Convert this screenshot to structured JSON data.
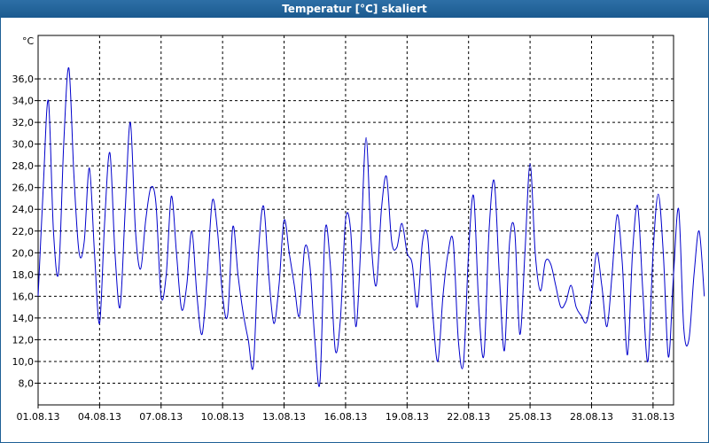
{
  "window": {
    "title": "Temperatur [°C] skaliert"
  },
  "chart_data": {
    "type": "line",
    "title": "Temperatur [°C] skaliert",
    "unit_label": "°C",
    "xlabel": "",
    "ylabel": "°C",
    "ylim": [
      6,
      40
    ],
    "xlim": [
      "2013-08-01",
      "2013-09-01"
    ],
    "yticks": [
      "8,0",
      "10,0",
      "12,0",
      "14,0",
      "16,0",
      "18,0",
      "20,0",
      "22,0",
      "24,0",
      "26,0",
      "28,0",
      "30,0",
      "32,0",
      "34,0",
      "36,0"
    ],
    "xticks": [
      "01.08.13",
      "04.08.13",
      "07.08.13",
      "10.08.13",
      "13.08.13",
      "16.08.13",
      "19.08.13",
      "22.08.13",
      "25.08.13",
      "28.08.13",
      "31.08.13"
    ],
    "grid": true,
    "grid_style": "dashed",
    "colors": {
      "line": "#0000cc",
      "grid": "#000000",
      "frame_bg": "#1e5f96",
      "plot_bg": "#ffffff"
    },
    "series": [
      {
        "values_per_day": 4,
        "values": [
          16.0,
          26.0,
          34.0,
          22.0,
          18.2,
          30.0,
          37.0,
          27.0,
          20.0,
          21.0,
          27.8,
          20.0,
          13.5,
          23.0,
          29.2,
          20.0,
          15.0,
          24.0,
          32.0,
          22.0,
          18.5,
          23.0,
          26.0,
          24.5,
          16.0,
          18.0,
          25.2,
          20.0,
          14.8,
          17.0,
          22.0,
          16.0,
          12.5,
          18.0,
          24.8,
          22.0,
          16.0,
          14.3,
          22.4,
          18.0,
          14.5,
          12.0,
          9.6,
          20.0,
          24.3,
          18.0,
          13.5,
          17.0,
          23.0,
          20.0,
          17.0,
          14.2,
          20.4,
          19.0,
          12.0,
          8.1,
          22.0,
          19.0,
          11.0,
          14.0,
          23.0,
          22.0,
          13.2,
          21.0,
          30.6,
          21.0,
          17.0,
          24.0,
          27.0,
          21.0,
          20.5,
          22.7,
          20.0,
          19.0,
          15.0,
          21.0,
          21.5,
          14.5,
          10.0,
          16.0,
          20.0,
          21.0,
          12.0,
          9.8,
          20.0,
          25.2,
          15.0,
          10.6,
          22.0,
          26.6,
          18.0,
          11.0,
          21.0,
          22.0,
          12.5,
          20.0,
          28.2,
          20.0,
          16.5,
          19.2,
          19.0,
          17.0,
          15.0,
          15.5,
          17.0,
          15.0,
          14.2,
          13.6,
          16.0,
          20.0,
          17.0,
          13.2,
          18.0,
          23.5,
          19.0,
          10.6,
          20.0,
          24.3,
          16.5,
          10.0,
          20.0,
          25.4,
          20.0,
          10.4,
          18.0,
          24.0,
          13.0,
          12.0,
          18.0,
          22.0,
          16.0
        ]
      }
    ]
  }
}
